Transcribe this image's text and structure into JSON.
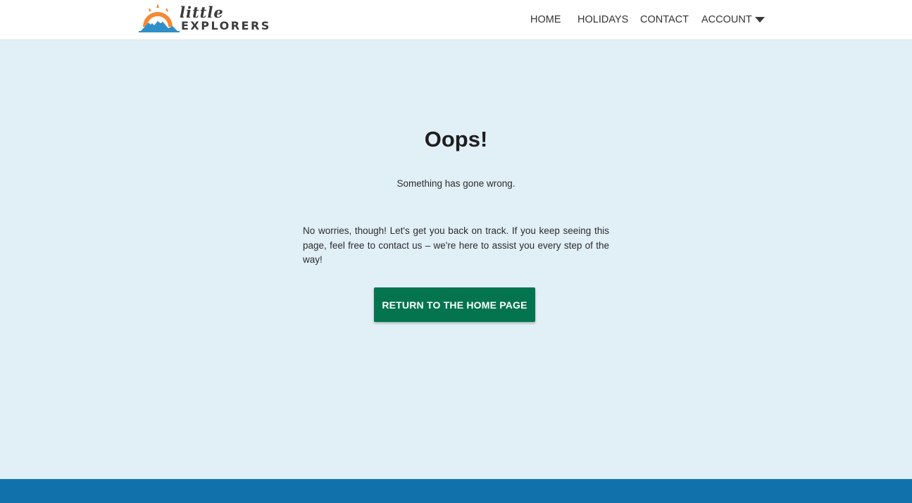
{
  "header": {
    "logo": {
      "line1": "little",
      "line2": "EXPLORERS"
    },
    "nav": [
      {
        "label": "HOME"
      },
      {
        "label": "HOLIDAYS"
      },
      {
        "label": "CONTACT"
      },
      {
        "label": "ACCOUNT"
      }
    ],
    "account_icon": "caret-down-icon"
  },
  "main": {
    "title": "Oops!",
    "subtitle": "Something has gone wrong.",
    "message": "No worries, though! Let's get you back on track. If you keep seeing this page, feel free to contact us – we're here to assist you every step of the way!",
    "button_label": "RETURN TO THE HOME PAGE"
  },
  "colors": {
    "header_bg": "#ffffff",
    "main_bg": "#e1eff7",
    "button_bg": "#04744f",
    "footer_bg": "#1172ab",
    "logo_sun": "#f28a35",
    "logo_mountain": "#2f8fc9"
  }
}
